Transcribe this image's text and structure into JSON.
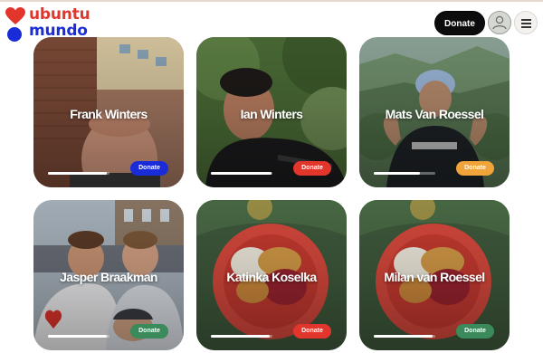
{
  "header": {
    "logo_line1": "ubuntu",
    "logo_line2": "mundo",
    "donate_label": "Donate"
  },
  "colors": {
    "brand_red": "#e2352c",
    "brand_blue": "#1a2bd8"
  },
  "cards": [
    {
      "name": "Frank Winters",
      "donate_label": "Donate",
      "donate_color": "#1a2bd8",
      "progress": 0.95
    },
    {
      "name": "Ian Winters",
      "donate_label": "Donate",
      "donate_color": "#e2352c",
      "progress": 0.98
    },
    {
      "name": "Mats Van Roessel",
      "donate_label": "Donate",
      "donate_color": "#f0a43a",
      "progress": 0.75
    },
    {
      "name": "Jasper Braakman",
      "donate_label": "Donate",
      "donate_color": "#3a8a5b",
      "progress": 0.95
    },
    {
      "name": "Katinka Koselka",
      "donate_label": "Donate",
      "donate_color": "#e2352c",
      "progress": 0.95
    },
    {
      "name": "Milan van Roessel",
      "donate_label": "Donate",
      "donate_color": "#3a8a5b",
      "progress": 0.95
    }
  ]
}
